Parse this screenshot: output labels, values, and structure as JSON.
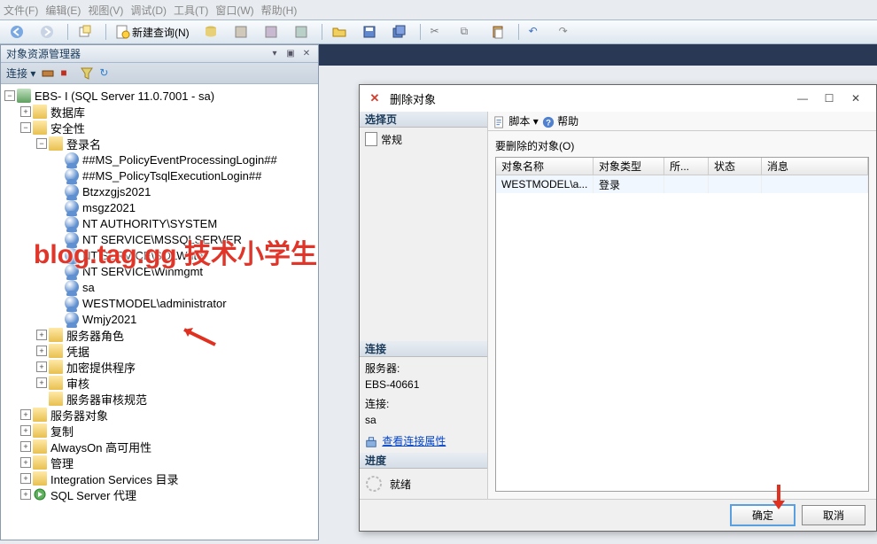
{
  "menubar": [
    "文件(F)",
    "编辑(E)",
    "视图(V)",
    "调试(D)",
    "工具(T)",
    "窗口(W)",
    "帮助(H)"
  ],
  "toolbar": {
    "new_query": "新建查询(N)"
  },
  "oe": {
    "title": "对象资源管理器",
    "connect": "连接",
    "root": "EBS-        I (SQL Server 11.0.7001 - sa)",
    "db": "数据库",
    "security": "安全性",
    "logins": "登录名",
    "login_items": [
      "##MS_PolicyEventProcessingLogin##",
      "##MS_PolicyTsqlExecutionLogin##",
      "Btzxzgjs2021",
      "msgz2021",
      "NT AUTHORITY\\SYSTEM",
      "NT SERVICE\\MSSQLSERVER",
      "NT SERVICE\\SQLWriter",
      "NT SERVICE\\Winmgmt",
      "sa",
      "WESTMODEL\\administrator",
      "Wmjy2021"
    ],
    "server_roles": "服务器角色",
    "credentials": "凭据",
    "crypto": "加密提供程序",
    "audit": "审核",
    "audit_spec": "服务器审核规范",
    "server_objects": "服务器对象",
    "replication": "复制",
    "alwayson": "AlwaysOn 高可用性",
    "management": "管理",
    "integration": "Integration Services 目录",
    "agent": "SQL Server 代理"
  },
  "dlg": {
    "title": "删除对象",
    "select_page": "选择页",
    "general": "常规",
    "script": "脚本",
    "help": "帮助",
    "to_delete": "要删除的对象(O)",
    "cols": {
      "name": "对象名称",
      "type": "对象类型",
      "owner": "所...",
      "status": "状态",
      "msg": "消息"
    },
    "row": {
      "name": "WESTMODEL\\a...",
      "type": "登录"
    },
    "connection": "连接",
    "server_lbl": "服务器:",
    "server_val": "EBS-40661",
    "conn_lbl": "连接:",
    "conn_val": "sa",
    "view_props": "查看连接属性",
    "progress": "进度",
    "ready": "就绪",
    "ok": "确定",
    "cancel": "取消"
  },
  "watermark": "blog.tag.gg 技术小学生"
}
